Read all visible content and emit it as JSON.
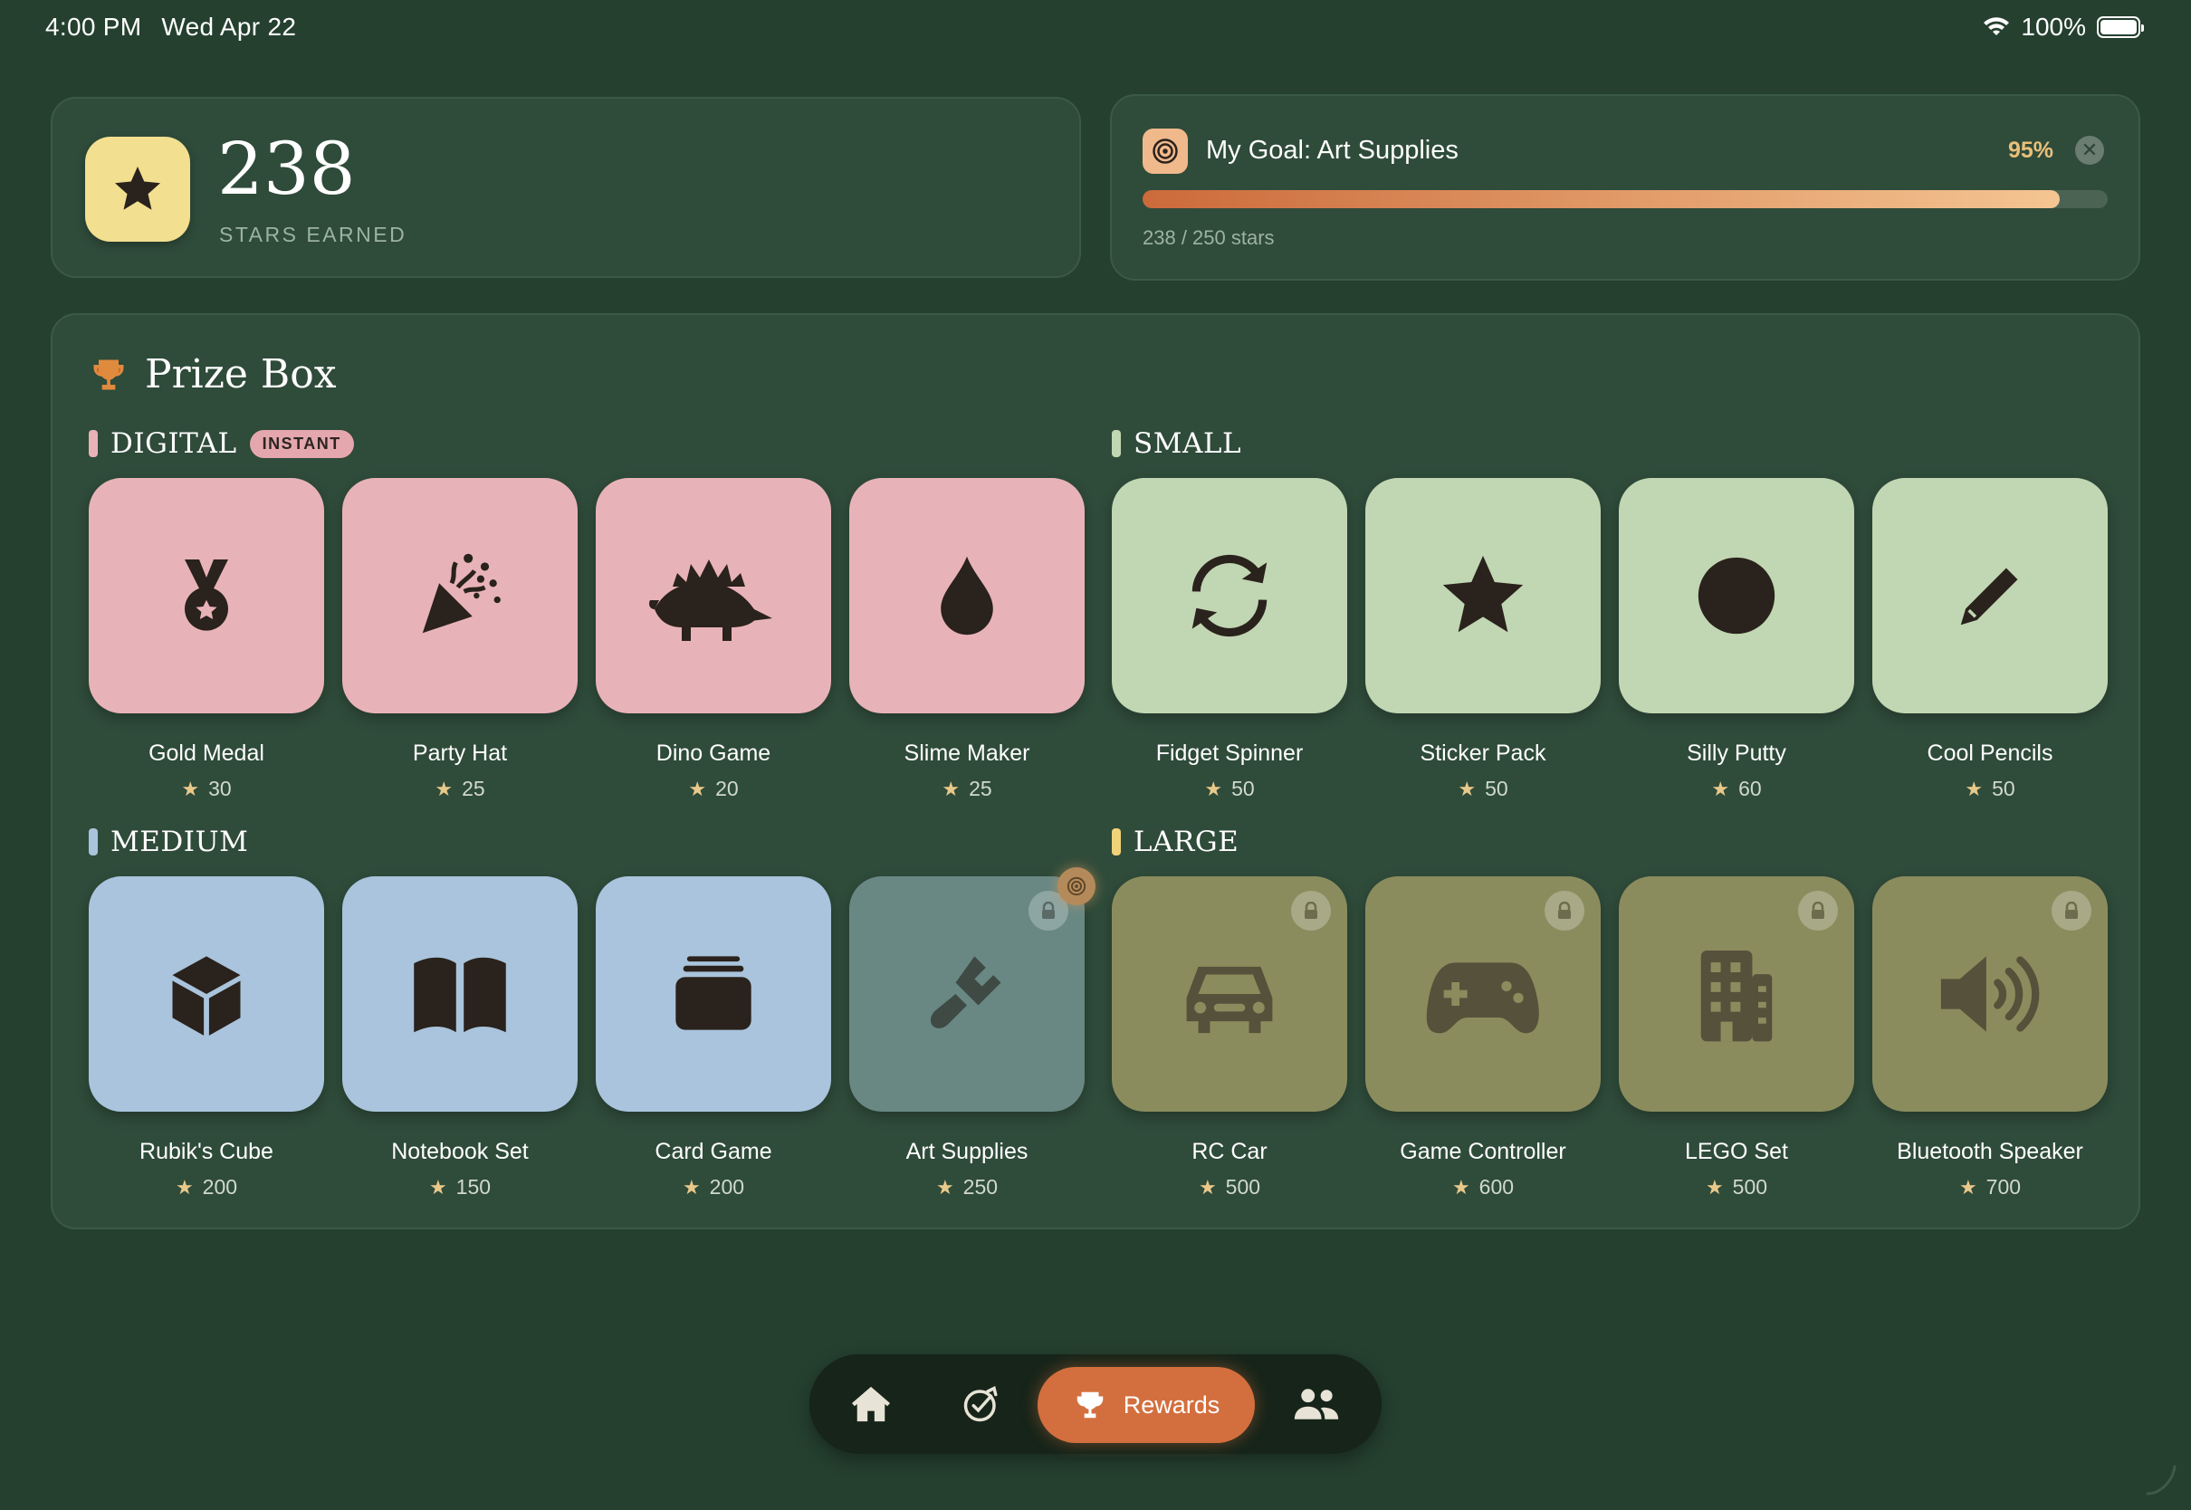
{
  "status_bar": {
    "time": "4:00 PM",
    "date": "Wed Apr 22",
    "battery": "100%"
  },
  "stars": {
    "count": "238",
    "label": "STARS EARNED"
  },
  "goal": {
    "title": "My Goal: Art Supplies",
    "percent": "95%",
    "progress": 0.95,
    "subtitle": "238 / 250 stars"
  },
  "prize_box": {
    "title": "Prize Box",
    "sections": {
      "digital": {
        "label": "DIGITAL",
        "badge": "INSTANT",
        "color": "#e8b3b8"
      },
      "small": {
        "label": "SMALL",
        "color": "#c1d6b2"
      },
      "medium": {
        "label": "MEDIUM",
        "color": "#a9c4dc"
      },
      "large": {
        "label": "LARGE",
        "color": "#f0d27a"
      }
    },
    "items": [
      {
        "name": "Gold Medal",
        "cost": "30",
        "icon": "medal-icon",
        "section": "digital",
        "locked": false
      },
      {
        "name": "Party Hat",
        "cost": "25",
        "icon": "party-popper-icon",
        "section": "digital",
        "locked": false
      },
      {
        "name": "Dino Game",
        "cost": "20",
        "icon": "dinosaur-icon",
        "section": "digital",
        "locked": false
      },
      {
        "name": "Slime Maker",
        "cost": "25",
        "icon": "drop-icon",
        "section": "digital",
        "locked": false
      },
      {
        "name": "Fidget Spinner",
        "cost": "50",
        "icon": "spin-arrows-icon",
        "section": "small",
        "locked": false
      },
      {
        "name": "Sticker Pack",
        "cost": "50",
        "icon": "star-icon",
        "section": "small",
        "locked": false
      },
      {
        "name": "Silly Putty",
        "cost": "60",
        "icon": "circle-icon",
        "section": "small",
        "locked": false
      },
      {
        "name": "Cool Pencils",
        "cost": "50",
        "icon": "pencil-icon",
        "section": "small",
        "locked": false
      },
      {
        "name": "Rubik's Cube",
        "cost": "200",
        "icon": "cube-icon",
        "section": "medium",
        "locked": false
      },
      {
        "name": "Notebook Set",
        "cost": "150",
        "icon": "book-icon",
        "section": "medium",
        "locked": false
      },
      {
        "name": "Card Game",
        "cost": "200",
        "icon": "card-stack-icon",
        "section": "medium",
        "locked": false
      },
      {
        "name": "Art Supplies",
        "cost": "250",
        "icon": "paintbrush-icon",
        "section": "medium",
        "locked": true
      },
      {
        "name": "RC Car",
        "cost": "500",
        "icon": "car-icon",
        "section": "large",
        "locked": true
      },
      {
        "name": "Game Controller",
        "cost": "600",
        "icon": "gamepad-icon",
        "section": "large",
        "locked": true
      },
      {
        "name": "LEGO Set",
        "cost": "500",
        "icon": "building-icon",
        "section": "large",
        "locked": true
      },
      {
        "name": "Bluetooth Speaker",
        "cost": "700",
        "icon": "speaker-icon",
        "section": "large",
        "locked": true
      }
    ]
  },
  "nav": {
    "active_label": "Rewards",
    "items": [
      "home-icon",
      "goal-check-icon",
      "trophy-icon",
      "people-icon"
    ]
  }
}
